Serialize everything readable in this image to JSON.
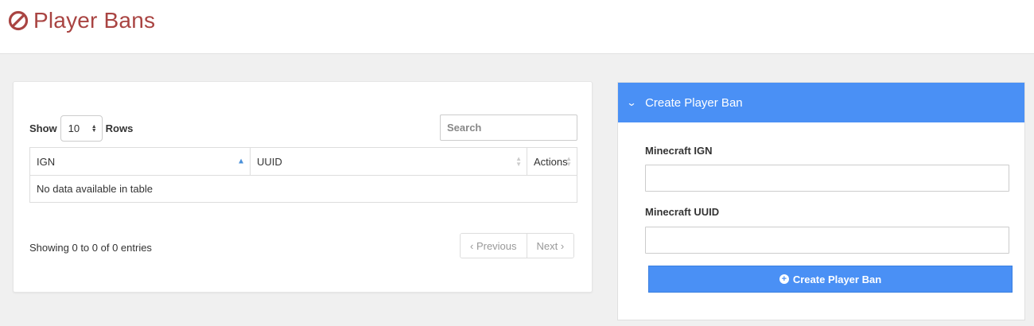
{
  "header": {
    "title": "Player Bans",
    "icon": "ban-icon",
    "title_color": "#a94442"
  },
  "table_panel": {
    "length": {
      "prefix": "Show",
      "value": "10",
      "suffix": "Rows"
    },
    "search": {
      "placeholder": "Search",
      "value": ""
    },
    "columns": [
      "IGN",
      "UUID",
      "Actions"
    ],
    "empty_text": "No data available in table",
    "info": "Showing 0 to 0 of 0 entries",
    "pagination": {
      "previous": "‹ Previous",
      "next": "Next ›"
    }
  },
  "form_panel": {
    "header": "Create Player Ban",
    "header_color": "#4a90f5",
    "fields": [
      {
        "label": "Minecraft IGN",
        "value": ""
      },
      {
        "label": "Minecraft UUID",
        "value": ""
      }
    ],
    "submit_label": "Create Player Ban",
    "submit_icon": "plus-circle-icon"
  }
}
